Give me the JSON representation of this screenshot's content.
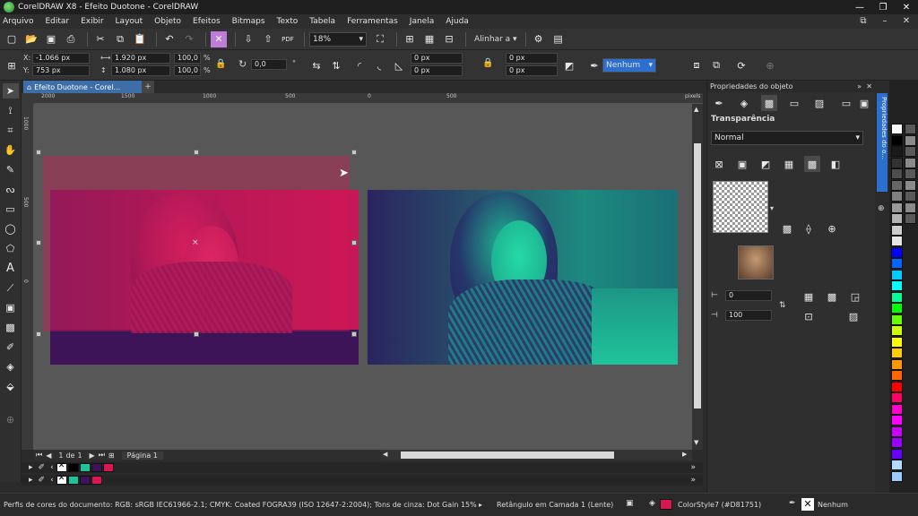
{
  "window": {
    "title": "CorelDRAW X8 - Efeito Duotone - CorelDRAW"
  },
  "menu": [
    "Arquivo",
    "Editar",
    "Exibir",
    "Layout",
    "Objeto",
    "Efeitos",
    "Bitmaps",
    "Texto",
    "Tabela",
    "Ferramentas",
    "Janela",
    "Ajuda"
  ],
  "toolbar": {
    "zoom": "18%",
    "align_label": "Alinhar a"
  },
  "propbar": {
    "x_label": "X:",
    "x_value": "-1.066 px",
    "y_label": "Y:",
    "y_value": "753 px",
    "width_value": "1.920 px",
    "height_value": "1.080 px",
    "scale_w": "100,0",
    "scale_h": "100,0",
    "pct": "%",
    "rotation": "0,0",
    "deg": "°",
    "corner1": "0 px",
    "corner2": "0 px",
    "corner3": "0 px",
    "corner4": "0 px",
    "outline_width": "Nenhum"
  },
  "document": {
    "tab_label": "Efeito Duotone - Corel...",
    "page_counter_current": "1",
    "page_counter_of": "de",
    "page_counter_total": "1",
    "page_tab": "Página 1"
  },
  "ruler": {
    "h_ticks": [
      "2000",
      "1500",
      "1000",
      "500",
      "0",
      "500"
    ],
    "h_unit": "pixels",
    "v_ticks": [
      "1000",
      "500",
      "0"
    ]
  },
  "panel": {
    "title": "Propriedades do objeto",
    "section": "Transparência",
    "merge_mode": "Normal",
    "transparency_value": "0",
    "opacity_value": "100"
  },
  "sidetab_label": "Propriedades do o...",
  "status": {
    "color_profile": "Perfis de cores do documento: RGB: sRGB IEC61966-2.1; CMYK: Coated FOGRA39 (ISO 12647-2:2004); Tons de cinza: Dot Gain 15%",
    "object_info": "Retângulo em Camada 1  (Lente)",
    "fill_label": "ColorStyle7 (#D81751)",
    "outline_label": "Nenhum"
  },
  "colors": {
    "magenta": "#D81751",
    "purple": "#3d1457",
    "teal": "#1fc39a",
    "navy": "#2a2460"
  },
  "palette_row1": [
    "#000000",
    "#1fc39a",
    "#3d1457",
    "#D81751"
  ],
  "palette_row2": [
    "#1fc39a",
    "#3d1457",
    "#D81751"
  ],
  "palette_col": [
    "#ffffff",
    "#000000",
    "#1a1a1a",
    "#333333",
    "#4d4d4d",
    "#666666",
    "#808080",
    "#999999",
    "#b3b3b3",
    "#cccccc",
    "#e6e6e6",
    "#0000ff",
    "#0066ff",
    "#00ccff",
    "#00ffff",
    "#00ff99",
    "#00ff00",
    "#66ff00",
    "#ccff00",
    "#ffff00",
    "#ffcc00",
    "#ff9900",
    "#ff6600",
    "#ff0000",
    "#ff0066",
    "#ff00cc",
    "#ff00ff",
    "#cc00ff",
    "#9900ff",
    "#6600ff",
    "#b3d9ff",
    "#99ccff"
  ]
}
